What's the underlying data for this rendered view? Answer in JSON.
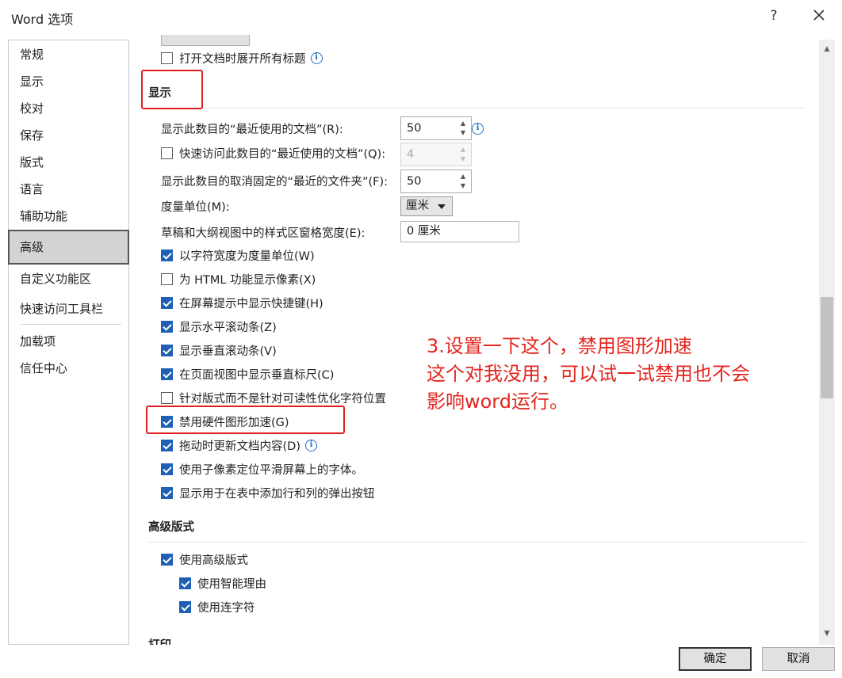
{
  "window": {
    "title": "Word 选项",
    "help_label": "?"
  },
  "sidebar": {
    "items": [
      {
        "label": "常规"
      },
      {
        "label": "显示"
      },
      {
        "label": "校对"
      },
      {
        "label": "保存"
      },
      {
        "label": "版式"
      },
      {
        "label": "语言"
      },
      {
        "label": "辅助功能"
      },
      {
        "label": "高级",
        "selected": true
      },
      {
        "label": "自定义功能区"
      },
      {
        "label": "快速访问工具栏"
      },
      {
        "label": "加载项"
      },
      {
        "label": "信任中心"
      }
    ]
  },
  "content": {
    "top_option": {
      "label": "打开文档时展开所有标题",
      "checked": false
    },
    "display_section": {
      "title": "显示",
      "recent_docs": {
        "label": "显示此数目的“最近使用的文档”(R):",
        "value": "50"
      },
      "quick_access": {
        "label": "快速访问此数目的“最近使用的文档”(Q):",
        "value": "4",
        "checked": false
      },
      "recent_folders": {
        "label": "显示此数目的取消固定的“最近的文件夹”(F):",
        "value": "50"
      },
      "units": {
        "label": "度量单位(M):",
        "value": "厘米"
      },
      "style_area": {
        "label": "草稿和大纲视图中的样式区窗格宽度(E):",
        "value": "0 厘米"
      },
      "checkboxes": [
        {
          "label": "以字符宽度为度量单位(W)",
          "checked": true
        },
        {
          "label": "为 HTML 功能显示像素(X)",
          "checked": false
        },
        {
          "label": "在屏幕提示中显示快捷键(H)",
          "checked": true
        },
        {
          "label": "显示水平滚动条(Z)",
          "checked": true
        },
        {
          "label": "显示垂直滚动条(V)",
          "checked": true
        },
        {
          "label": "在页面视图中显示垂直标尺(C)",
          "checked": true
        },
        {
          "label": "针对版式而不是针对可读性优化字符位置",
          "checked": false
        },
        {
          "label": "禁用硬件图形加速(G)",
          "checked": true
        },
        {
          "label": "拖动时更新文档内容(D)",
          "checked": true
        },
        {
          "label": "使用子像素定位平滑屏幕上的字体。",
          "checked": true
        },
        {
          "label": "显示用于在表中添加行和列的弹出按钮",
          "checked": true
        }
      ]
    },
    "advanced_layout_section": {
      "title": "高级版式",
      "items": [
        {
          "label": "使用高级版式",
          "checked": true
        },
        {
          "label": "使用智能理由",
          "checked": true
        },
        {
          "label": "使用连字符",
          "checked": true
        }
      ]
    },
    "next_section_partial": "打印"
  },
  "annotation": {
    "lines": [
      "3.设置一下这个，禁用图形加速",
      "这个对我没用，可以试一试禁用也不会",
      "影响word运行。"
    ],
    "color": "#e3261e"
  },
  "footer": {
    "ok_label": "确定",
    "cancel_label": "取消"
  }
}
